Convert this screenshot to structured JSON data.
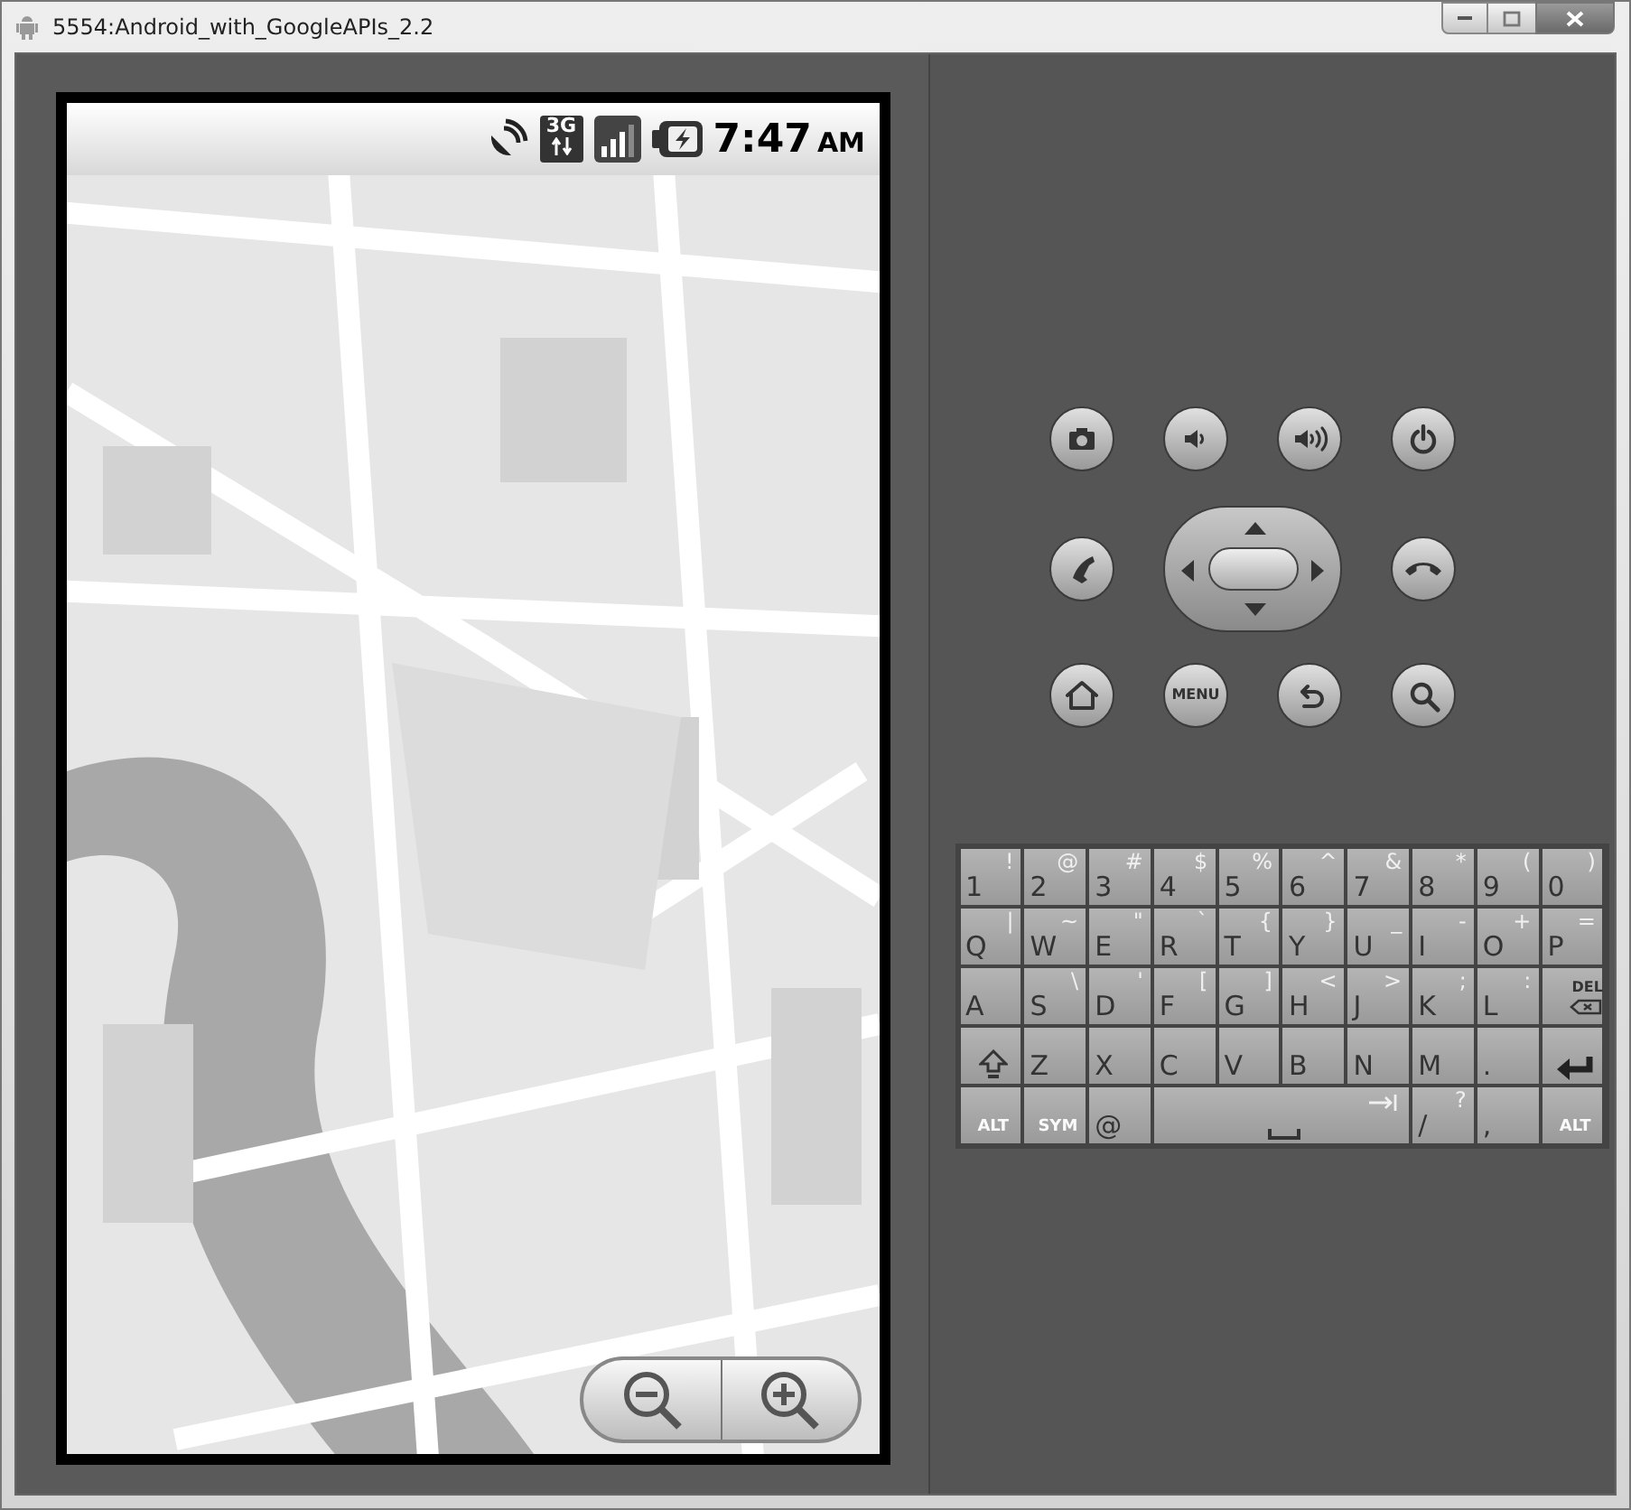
{
  "window": {
    "title": "5554:Android_with_GoogleAPIs_2.2"
  },
  "status_bar": {
    "network": "3G",
    "time": "7:47",
    "meridiem": "AM"
  },
  "map": {
    "kind": "picture"
  },
  "hard_buttons": [
    {
      "kind": "camera"
    },
    {
      "kind": "volume-down"
    },
    {
      "kind": "volume-up"
    },
    {
      "kind": "power"
    },
    {
      "kind": "call"
    },
    {
      "kind": "dpad"
    },
    {
      "kind": "end-call"
    },
    {
      "kind": "home"
    },
    {
      "kind": "menu",
      "label": "MENU"
    },
    {
      "kind": "back"
    },
    {
      "kind": "search"
    }
  ],
  "keyboard": [
    [
      {
        "kind": "char",
        "main": "1",
        "alt": "!"
      },
      {
        "kind": "char",
        "main": "2",
        "alt": "@"
      },
      {
        "kind": "char",
        "main": "3",
        "alt": "#"
      },
      {
        "kind": "char",
        "main": "4",
        "alt": "$"
      },
      {
        "kind": "char",
        "main": "5",
        "alt": "%"
      },
      {
        "kind": "char",
        "main": "6",
        "alt": "^"
      },
      {
        "kind": "char",
        "main": "7",
        "alt": "&"
      },
      {
        "kind": "char",
        "main": "8",
        "alt": "*"
      },
      {
        "kind": "char",
        "main": "9",
        "alt": "("
      },
      {
        "kind": "char",
        "main": "0",
        "alt": ")"
      }
    ],
    [
      {
        "kind": "char",
        "main": "Q",
        "alt": "|"
      },
      {
        "kind": "char",
        "main": "W",
        "alt": "~"
      },
      {
        "kind": "char",
        "main": "E",
        "alt": "\""
      },
      {
        "kind": "char",
        "main": "R",
        "alt": "`"
      },
      {
        "kind": "char",
        "main": "T",
        "alt": "{"
      },
      {
        "kind": "char",
        "main": "Y",
        "alt": "}"
      },
      {
        "kind": "char",
        "main": "U",
        "alt": "_"
      },
      {
        "kind": "char",
        "main": "I",
        "alt": "-"
      },
      {
        "kind": "char",
        "main": "O",
        "alt": "+"
      },
      {
        "kind": "char",
        "main": "P",
        "alt": "="
      }
    ],
    [
      {
        "kind": "char",
        "main": "A"
      },
      {
        "kind": "char",
        "main": "S",
        "alt": "\\"
      },
      {
        "kind": "char",
        "main": "D",
        "alt": "'"
      },
      {
        "kind": "char",
        "main": "F",
        "alt": "["
      },
      {
        "kind": "char",
        "main": "G",
        "alt": "]"
      },
      {
        "kind": "char",
        "main": "H",
        "alt": "<"
      },
      {
        "kind": "char",
        "main": "J",
        "alt": ">"
      },
      {
        "kind": "char",
        "main": "K",
        "alt": ";"
      },
      {
        "kind": "char",
        "main": "L",
        "alt": ":"
      },
      {
        "kind": "del",
        "label": "DEL"
      }
    ],
    [
      {
        "kind": "shift"
      },
      {
        "kind": "char",
        "main": "Z"
      },
      {
        "kind": "char",
        "main": "X"
      },
      {
        "kind": "char",
        "main": "C"
      },
      {
        "kind": "char",
        "main": "V"
      },
      {
        "kind": "char",
        "main": "B"
      },
      {
        "kind": "char",
        "main": "N"
      },
      {
        "kind": "char",
        "main": "M"
      },
      {
        "kind": "char",
        "main": "."
      },
      {
        "kind": "enter"
      }
    ],
    [
      {
        "kind": "mod",
        "label": "ALT"
      },
      {
        "kind": "mod",
        "label": "SYM"
      },
      {
        "kind": "char",
        "main": "@"
      },
      {
        "kind": "space"
      },
      {
        "kind": "char",
        "main": "/",
        "alt": "?"
      },
      {
        "kind": "char",
        "main": ","
      },
      {
        "kind": "mod",
        "label": "ALT"
      }
    ]
  ]
}
